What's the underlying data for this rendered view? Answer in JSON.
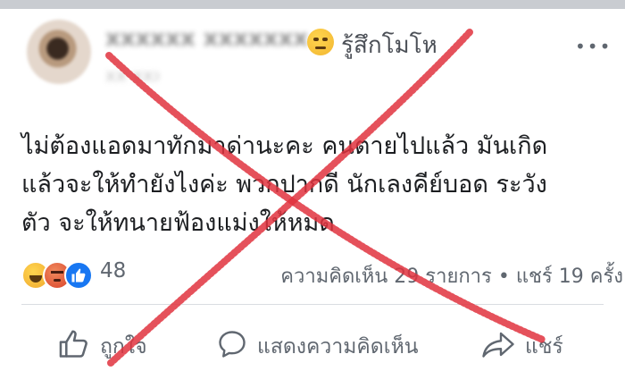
{
  "header": {
    "author_name": "xxxxxx xxxxxxx",
    "sub_meta": "xx xxx",
    "feeling_emoji": "sad-face-icon",
    "feeling_text": "รู้สึกโมโห",
    "more_label": "•••"
  },
  "post": {
    "lines": [
      "ไม่ต้องแอดมาทักมาด่านะคะ คนตายไปแล้ว มันเกิด",
      "แล้วจะให้ทำยังไงค่ะ พวกปากดี นักเลงคีย์บอด ระวัง",
      "ตัว จะให้ทนายฟ้องแม่งให้หมด"
    ]
  },
  "reactions": {
    "icons": [
      "haha-icon",
      "angry-icon",
      "like-icon"
    ],
    "count": "48",
    "comments": "ความคิดเห็น 29 รายการ",
    "separator": "•",
    "shares": "แชร์ 19 ครั้ง"
  },
  "actions": {
    "like": "ถูกใจ",
    "comment": "แสดงความคิดเห็น",
    "share": "แชร์"
  },
  "colors": {
    "overlay_x": "#e0323e",
    "like_blue": "#1877f2",
    "meta_gray": "#606770",
    "text": "#1c1e21"
  }
}
